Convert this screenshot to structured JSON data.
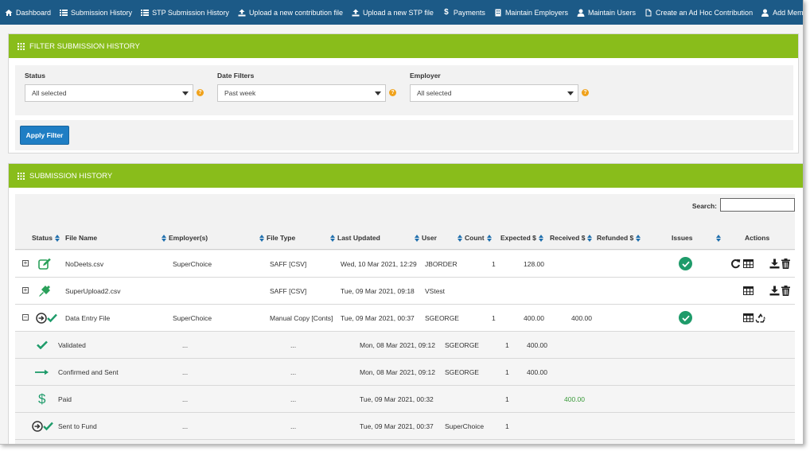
{
  "nav": [
    {
      "label": "Dashboard",
      "icon": "home-icon"
    },
    {
      "label": "Submission History",
      "icon": "list-icon"
    },
    {
      "label": "STP Submission History",
      "icon": "list-icon"
    },
    {
      "label": "Upload a new contribution file",
      "icon": "upload-icon"
    },
    {
      "label": "Upload a new STP file",
      "icon": "upload-icon"
    },
    {
      "label": "Payments",
      "icon": "dollar-icon"
    },
    {
      "label": "Maintain Employers",
      "icon": "building-icon"
    },
    {
      "label": "Maintain Users",
      "icon": "user-icon"
    },
    {
      "label": "Create an Ad Hoc Contribution",
      "icon": "document-icon"
    },
    {
      "label": "Add Member",
      "icon": "user-add-icon"
    }
  ],
  "filter": {
    "title": "FILTER SUBMISSION HISTORY",
    "status_label": "Status",
    "status_value": "All selected",
    "date_label": "Date Filters",
    "date_value": "Past week",
    "employer_label": "Employer",
    "employer_value": "All selected",
    "help_glyph": "?",
    "apply_label": "Apply Filter"
  },
  "history": {
    "title": "SUBMISSION HISTORY",
    "search_label": "Search:",
    "columns": {
      "status": "Status",
      "file_name": "File Name",
      "employers": "Employer(s)",
      "file_type": "File Type",
      "last_updated": "Last Updated",
      "user": "User",
      "count": "Count",
      "expected": "Expected $",
      "received": "Received $",
      "refunded": "Refunded $",
      "issues": "Issues",
      "actions": "Actions"
    },
    "rows": [
      {
        "expander": "+",
        "file_name": "NoDeets.csv",
        "employer": "SuperChoice",
        "file_type": "SAFF [CSV]",
        "last_updated": "Wed, 10 Mar 2021, 12:29",
        "user": "JBORDER",
        "count": "1",
        "expected": "128.00",
        "received": "",
        "status_icon": "edit-icon"
      },
      {
        "expander": "+",
        "file_name": "SuperUpload2.csv",
        "employer": "",
        "file_type": "SAFF [CSV]",
        "last_updated": "Tue, 09 Mar 2021, 09:18",
        "user": "VStest",
        "count": "",
        "expected": "",
        "received": "",
        "status_icon": "plug-icon"
      },
      {
        "expander": "−",
        "file_name": "Data Entry File",
        "employer": "SuperChoice",
        "file_type": "Manual Copy [Conts]",
        "last_updated": "Tue, 09 Mar 2021, 00:37",
        "user": "SGEORGE",
        "count": "1",
        "expected": "400.00",
        "received": "400.00",
        "status_icon": "sent-to-fund-icon"
      }
    ],
    "sub_rows": [
      {
        "label": "Validated",
        "employer": "...",
        "file_type": "...",
        "last_updated": "Mon, 08 Mar 2021, 09:12",
        "user": "SGEORGE",
        "count": "1",
        "expected": "400.00",
        "received": ""
      },
      {
        "label": "Confirmed and Sent",
        "employer": "...",
        "file_type": "...",
        "last_updated": "Mon, 08 Mar 2021, 09:12",
        "user": "SGEORGE",
        "count": "1",
        "expected": "400.00",
        "received": ""
      },
      {
        "label": "Paid",
        "employer": "...",
        "file_type": "...",
        "last_updated": "Tue, 09 Mar 2021, 00:32",
        "user": "",
        "count": "1",
        "expected": "",
        "received": "400.00"
      },
      {
        "label": "Sent to Fund",
        "employer": "...",
        "file_type": "...",
        "last_updated": "Tue, 09 Mar 2021, 00:37",
        "user": "SuperChoice",
        "count": "1",
        "expected": "",
        "received": ""
      }
    ]
  },
  "colors": {
    "nav_bg": "#1c5a87",
    "panel_green": "#89bd1b",
    "button_blue": "#1f7ec4",
    "ok_green": "#1e9b6a"
  }
}
